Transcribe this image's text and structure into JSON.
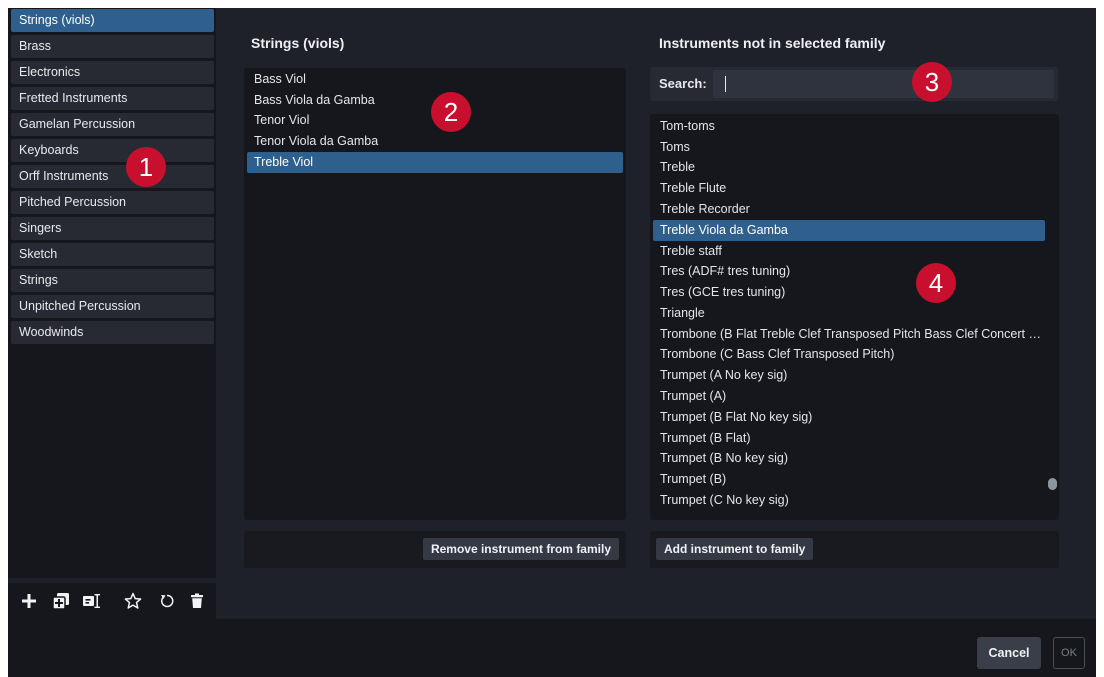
{
  "families": [
    "Strings (viols)",
    "Brass",
    "Electronics",
    "Fretted Instruments",
    "Gamelan Percussion",
    "Keyboards",
    "Orff Instruments",
    "Pitched Percussion",
    "Singers",
    "Sketch",
    "Strings",
    "Unpitched Percussion",
    "Woodwinds"
  ],
  "selected_family_index": 0,
  "toolbar_icons": [
    "add-icon",
    "duplicate-icon",
    "rename-icon",
    "favorite-star-icon",
    "reset-icon",
    "delete-icon"
  ],
  "middle": {
    "title": "Strings (viols)",
    "items": [
      "Bass Viol",
      "Bass Viola da Gamba",
      "Tenor Viol",
      "Tenor Viola da Gamba",
      "Treble Viol"
    ],
    "selected_index": 4,
    "remove_button": "Remove instrument from family"
  },
  "right": {
    "title": "Instruments not in selected family",
    "search_label": "Search:",
    "search_value": "",
    "items": [
      "Tom-toms",
      "Toms",
      "Treble",
      "Treble Flute",
      "Treble Recorder",
      "Treble Viola da Gamba",
      "Treble staff",
      "Tres (ADF# tres tuning)",
      "Tres (GCE tres tuning)",
      "Triangle",
      "Trombone (B Flat Treble Clef Transposed Pitch Bass Clef Concert …",
      "Trombone (C Bass Clef Transposed Pitch)",
      "Trumpet (A No key sig)",
      "Trumpet (A)",
      "Trumpet (B Flat No key sig)",
      "Trumpet (B Flat)",
      "Trumpet (B No key sig)",
      "Trumpet (B)",
      "Trumpet (C No key sig)"
    ],
    "selected_index": 5,
    "add_button": "Add instrument to family"
  },
  "callouts": [
    "1",
    "2",
    "3",
    "4"
  ],
  "footer": {
    "cancel": "Cancel",
    "ok": "OK"
  },
  "colors": {
    "selection": "#2e5f8d",
    "callout": "#c8102e"
  }
}
